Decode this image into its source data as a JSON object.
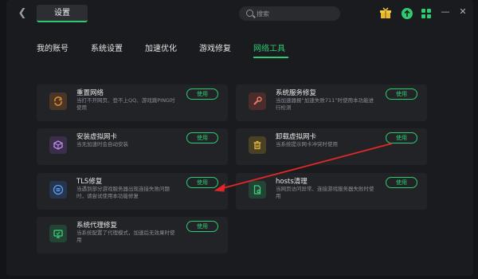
{
  "titlebar": {
    "back_icon": "chevron-left-icon",
    "active_tab": "设置",
    "search_placeholder": "搜索",
    "icons": [
      "gift-icon",
      "upload-icon",
      "apps-icon"
    ],
    "minimize": "minimize-icon",
    "close": "close-icon"
  },
  "nav": {
    "tabs": [
      "我的账号",
      "系统设置",
      "加速优化",
      "游戏修复",
      "网络工具"
    ],
    "active": "网络工具"
  },
  "cards": [
    {
      "title": "重置网络",
      "desc": "当打不开网页、登不上QQ、游戏跳PING时使用",
      "button": "使用",
      "icon": "reset-icon",
      "icon_color": "#e0892e",
      "icon_bg": "#4a3626"
    },
    {
      "title": "系统服务修复",
      "desc": "当加速器报“加速失败711”时使用本功能进行检测",
      "button": "使用",
      "icon": "wrench-icon",
      "icon_color": "#e97a6a",
      "icon_bg": "#4a2c2a"
    },
    {
      "title": "安装虚拟网卡",
      "desc": "当无加速时会自动安装",
      "button": "使用",
      "icon": "cube-icon",
      "icon_color": "#b98ae6",
      "icon_bg": "#3b2e4a"
    },
    {
      "title": "卸载虚拟网卡",
      "desc": "当系统提示网卡冲突时使用",
      "button": "使用",
      "icon": "trash-icon",
      "icon_color": "#e0b63a",
      "icon_bg": "#4a4024"
    },
    {
      "title": "TLS修复",
      "desc": "当遇到部分游戏服务器出现连接失败问题时，请尝试使用本功能修复",
      "button": "使用",
      "icon": "list-icon",
      "icon_color": "#5b9ef0",
      "icon_bg": "#25354d"
    },
    {
      "title": "hosts清理",
      "desc": "当网页访问异常、连接游戏服务器失败时使用",
      "button": "使用",
      "icon": "file-icon",
      "icon_color": "#3ecf79",
      "icon_bg": "#234435"
    },
    {
      "title": "系统代理修复",
      "desc": "当系统配置了代理模式，加速后无效果时使用",
      "button": "使用",
      "icon": "monitor-icon",
      "icon_color": "#3ecf79",
      "icon_bg": "#234435"
    }
  ],
  "colors": {
    "accent": "#2ecc71",
    "annotation_arrow": "#e0282a"
  }
}
